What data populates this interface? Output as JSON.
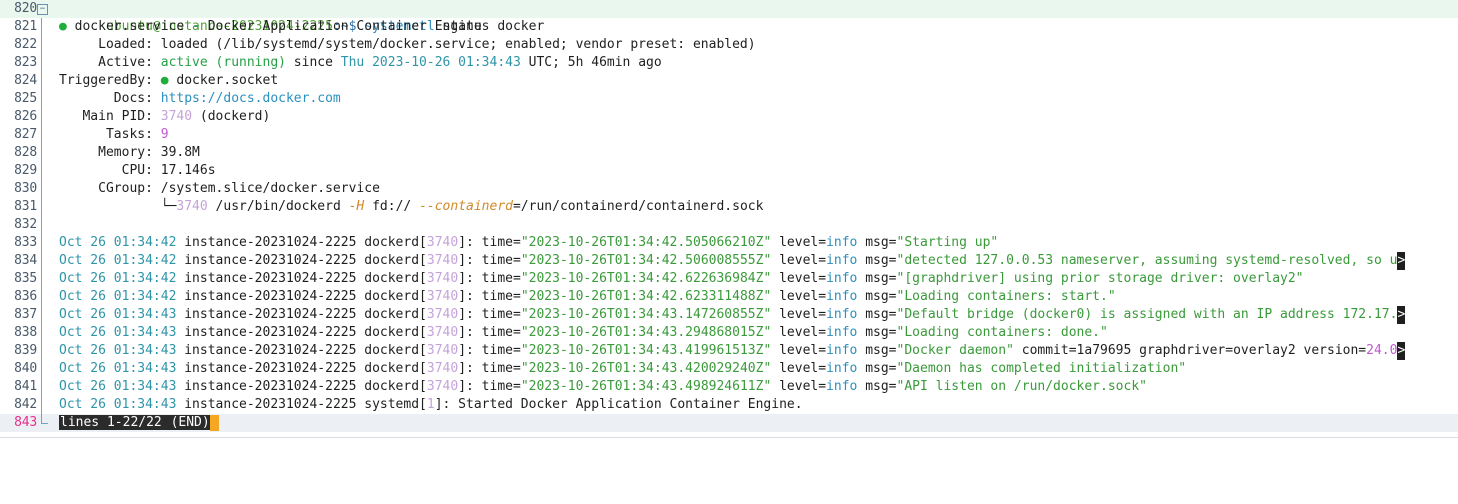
{
  "prompt": {
    "user_host": "ubuntu@instance-20231024-2225",
    "path_sym": ":~$ ",
    "command": "systemctl",
    "args": " status docker"
  },
  "line_numbers": [
    "820",
    "821",
    "822",
    "823",
    "824",
    "825",
    "826",
    "827",
    "828",
    "829",
    "830",
    "831",
    "832",
    "833",
    "834",
    "835",
    "836",
    "837",
    "838",
    "839",
    "840",
    "841",
    "842",
    "843"
  ],
  "status": {
    "dot": "●",
    "unit": " docker.service",
    "sep": " - ",
    "desc": "Docker Application Container Engine",
    "loaded_key": "     Loaded: ",
    "loaded_val": "loaded (/lib/systemd/system/docker.service; enabled; vendor preset: enabled)",
    "active_key": "     Active: ",
    "active_state": "active (running)",
    "active_since": " since ",
    "active_time": "Thu 2023-10-26 01:34:43",
    "active_rest": " UTC; 5h 46min ago",
    "triggered_key": "TriggeredBy: ",
    "triggered_dot": "●",
    "triggered_val": " docker.socket",
    "docs_key": "       Docs: ",
    "docs_val": "https://docs.docker.com",
    "pid_key": "   Main PID: ",
    "pid_num": "3740",
    "pid_name": " (dockerd)",
    "tasks_key": "      Tasks: ",
    "tasks_val": "9",
    "mem_key": "     Memory: ",
    "mem_val": "39.8M",
    "cpu_key": "        CPU: ",
    "cpu_val": "17.146s",
    "cgroup_key": "     CGroup: ",
    "cgroup_val": "/system.slice/docker.service",
    "tree_prefix": "             └─",
    "tree_pid": "3740",
    "tree_bin": " /usr/bin/dockerd ",
    "tree_h": "-H",
    "tree_fd": " fd:// ",
    "tree_ctrd": "--containerd",
    "tree_sock": "=/run/containerd/containerd.sock"
  },
  "logs": [
    {
      "date": "Oct 26 01:34:42",
      "host": " instance-20231024-2225 ",
      "proc": "dockerd",
      "pid": "3740",
      "pre": ": time=",
      "time": "\"2023-10-26T01:34:42.505066210Z\"",
      "lvl": " level=",
      "lvlval": "info",
      "msgk": " msg=",
      "msg": "\"Starting up\"",
      "extra": "",
      "trunc": ""
    },
    {
      "date": "Oct 26 01:34:42",
      "host": " instance-20231024-2225 ",
      "proc": "dockerd",
      "pid": "3740",
      "pre": ": time=",
      "time": "\"2023-10-26T01:34:42.506008555Z\"",
      "lvl": " level=",
      "lvlval": "info",
      "msgk": " msg=",
      "msg": "\"detected 127.0.0.53 nameserver, assuming systemd-resolved, so u",
      "extra": "",
      "trunc": ">"
    },
    {
      "date": "Oct 26 01:34:42",
      "host": " instance-20231024-2225 ",
      "proc": "dockerd",
      "pid": "3740",
      "pre": ": time=",
      "time": "\"2023-10-26T01:34:42.622636984Z\"",
      "lvl": " level=",
      "lvlval": "info",
      "msgk": " msg=",
      "msg": "\"[graphdriver] using prior storage driver: overlay2\"",
      "extra": "",
      "trunc": ""
    },
    {
      "date": "Oct 26 01:34:42",
      "host": " instance-20231024-2225 ",
      "proc": "dockerd",
      "pid": "3740",
      "pre": ": time=",
      "time": "\"2023-10-26T01:34:42.623311488Z\"",
      "lvl": " level=",
      "lvlval": "info",
      "msgk": " msg=",
      "msg": "\"Loading containers: start.\"",
      "extra": "",
      "trunc": ""
    },
    {
      "date": "Oct 26 01:34:43",
      "host": " instance-20231024-2225 ",
      "proc": "dockerd",
      "pid": "3740",
      "pre": ": time=",
      "time": "\"2023-10-26T01:34:43.147260855Z\"",
      "lvl": " level=",
      "lvlval": "info",
      "msgk": " msg=",
      "msg": "\"Default bridge (docker0) is assigned with an IP address 172.17.",
      "extra": "",
      "trunc": ">"
    },
    {
      "date": "Oct 26 01:34:43",
      "host": " instance-20231024-2225 ",
      "proc": "dockerd",
      "pid": "3740",
      "pre": ": time=",
      "time": "\"2023-10-26T01:34:43.294868015Z\"",
      "lvl": " level=",
      "lvlval": "info",
      "msgk": " msg=",
      "msg": "\"Loading containers: done.\"",
      "extra": "",
      "trunc": ""
    },
    {
      "date": "Oct 26 01:34:43",
      "host": " instance-20231024-2225 ",
      "proc": "dockerd",
      "pid": "3740",
      "pre": ": time=",
      "time": "\"2023-10-26T01:34:43.419961513Z\"",
      "lvl": " level=",
      "lvlval": "info",
      "msgk": " msg=",
      "msg": "\"Docker daemon\"",
      "extra": " commit=1a79695 graphdriver=overlay2 version=",
      "extraver": "24.0",
      "trunc": ">"
    },
    {
      "date": "Oct 26 01:34:43",
      "host": " instance-20231024-2225 ",
      "proc": "dockerd",
      "pid": "3740",
      "pre": ": time=",
      "time": "\"2023-10-26T01:34:43.420029240Z\"",
      "lvl": " level=",
      "lvlval": "info",
      "msgk": " msg=",
      "msg": "\"Daemon has completed initialization\"",
      "extra": "",
      "trunc": ""
    },
    {
      "date": "Oct 26 01:34:43",
      "host": " instance-20231024-2225 ",
      "proc": "dockerd",
      "pid": "3740",
      "pre": ": time=",
      "time": "\"2023-10-26T01:34:43.498924611Z\"",
      "lvl": " level=",
      "lvlval": "info",
      "msgk": " msg=",
      "msg": "\"API listen on /run/docker.sock\"",
      "extra": "",
      "trunc": ""
    }
  ],
  "final_log": {
    "date": "Oct 26 01:34:43",
    "host": " instance-20231024-2225 ",
    "proc": "systemd",
    "pid": "1",
    "rest": ": Started Docker Application Container Engine."
  },
  "pager": {
    "lines": "lines 1-22/22 ",
    "end": "(END)"
  },
  "icons": {
    "fold": "fold-collapse-icon",
    "cursor": "cursor-block"
  },
  "colors": {
    "current_line_number": "#e8308c",
    "first_line_bg": "#eaf7ee",
    "cursor": "#f5a623"
  }
}
